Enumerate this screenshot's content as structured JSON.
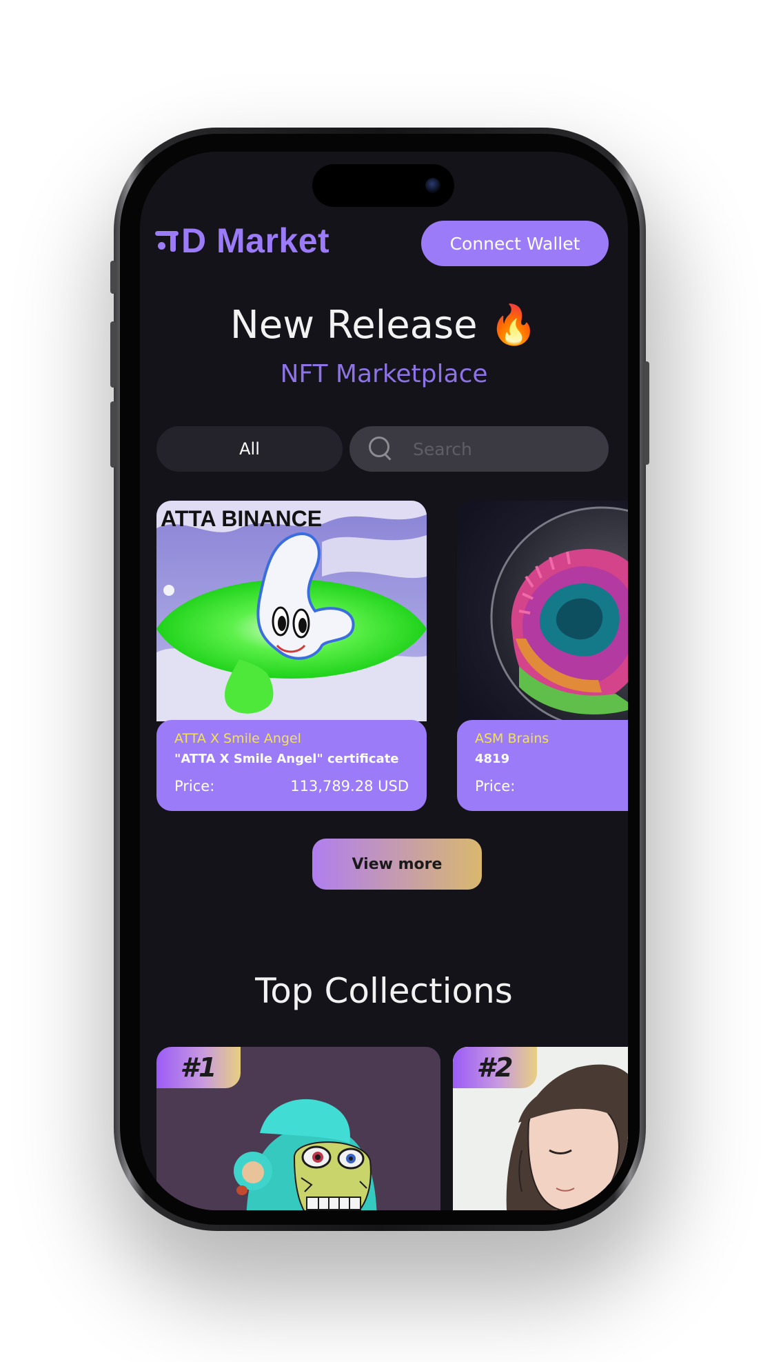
{
  "app": {
    "logo": "D Market",
    "connect_wallet": "Connect Wallet"
  },
  "hero": {
    "title": "New Release 🔥",
    "subtitle": "NFT Marketplace"
  },
  "filter": {
    "all_label": "All",
    "search_placeholder": "Search"
  },
  "nfts": [
    {
      "art_text": "ATTA BINANCE",
      "collection": "ATTA X Smile Angel",
      "name": "\"ATTA X Smile Angel\" certificate",
      "price_label": "Price:",
      "price": "113,789.28 USD"
    },
    {
      "collection": "ASM Brains",
      "name": "4819",
      "price_label": "Price:",
      "price": ""
    }
  ],
  "view_more": "View more",
  "top_collections": {
    "title": "Top Collections",
    "ranks": [
      "#1",
      "#2"
    ]
  },
  "colors": {
    "accent": "#9b7bf7",
    "background": "#14131a",
    "price_highlight": "#f2e25a"
  }
}
